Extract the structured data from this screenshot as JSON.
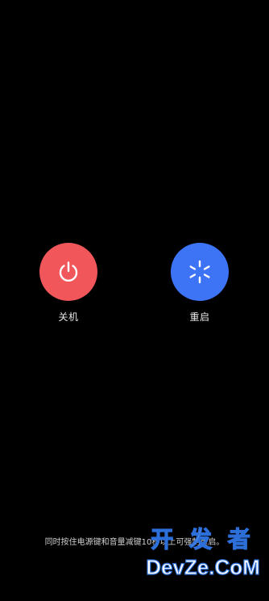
{
  "colors": {
    "background": "#000000",
    "shutdown_button": "#f0565a",
    "restart_button": "#3d74f5",
    "icon": "#ffffff",
    "label": "#e6e6e6"
  },
  "power_menu": {
    "shutdown": {
      "label": "关机",
      "icon": "power-icon"
    },
    "restart": {
      "label": "重启",
      "icon": "restart-icon"
    }
  },
  "hint": {
    "text": "同时按住电源键和音量减键10秒以上可强制重启。"
  },
  "watermark": {
    "line1": "开 发 者",
    "line2": "DevZe.CoM"
  }
}
